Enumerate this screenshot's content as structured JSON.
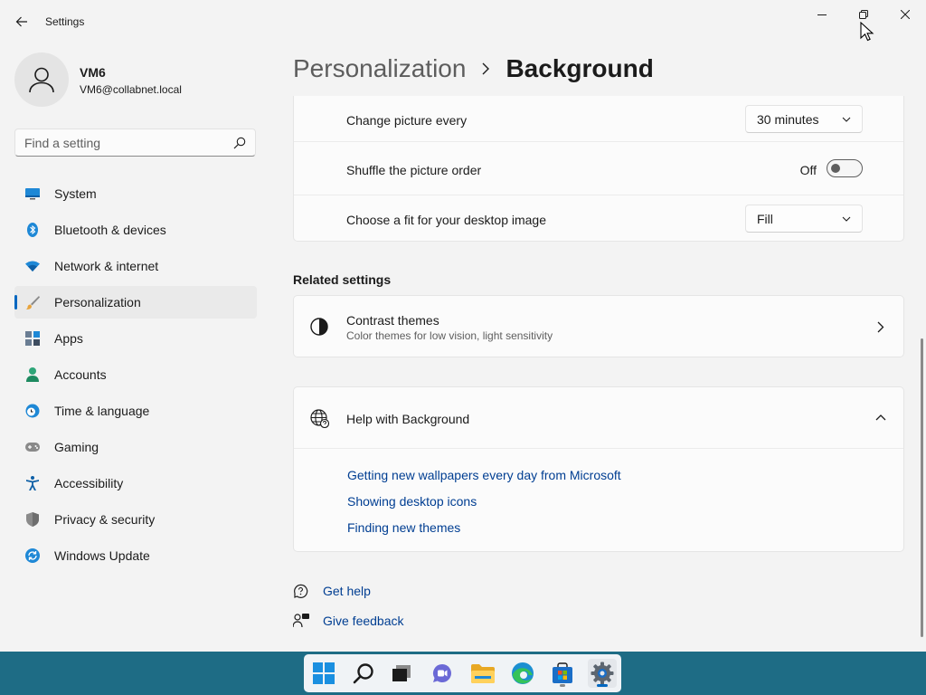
{
  "window": {
    "title": "Settings",
    "minimize_glyph": "—",
    "accent": "#0067c0"
  },
  "user": {
    "name": "VM6",
    "email": "VM6@collabnet.local"
  },
  "search": {
    "placeholder": "Find a setting"
  },
  "nav": [
    {
      "label": "System",
      "icon": "monitor-icon"
    },
    {
      "label": "Bluetooth & devices",
      "icon": "bluetooth-icon"
    },
    {
      "label": "Network & internet",
      "icon": "wifi-icon"
    },
    {
      "label": "Personalization",
      "icon": "brush-icon",
      "active": true
    },
    {
      "label": "Apps",
      "icon": "apps-icon"
    },
    {
      "label": "Accounts",
      "icon": "person-icon"
    },
    {
      "label": "Time & language",
      "icon": "globe-clock-icon"
    },
    {
      "label": "Gaming",
      "icon": "gamepad-icon"
    },
    {
      "label": "Accessibility",
      "icon": "accessibility-icon"
    },
    {
      "label": "Privacy & security",
      "icon": "shield-icon"
    },
    {
      "label": "Windows Update",
      "icon": "update-icon"
    }
  ],
  "breadcrumb": {
    "parent": "Personalization",
    "current": "Background"
  },
  "slideshow": {
    "change_label": "Change picture every",
    "change_value": "30 minutes",
    "shuffle_label": "Shuffle the picture order",
    "shuffle_state": "Off",
    "fit_label": "Choose a fit for your desktop image",
    "fit_value": "Fill"
  },
  "related": {
    "title": "Related settings",
    "contrast_title": "Contrast themes",
    "contrast_desc": "Color themes for low vision, light sensitivity"
  },
  "help": {
    "title": "Help with Background",
    "links": [
      "Getting new wallpapers every day from Microsoft",
      "Showing desktop icons",
      "Finding new themes"
    ]
  },
  "footer": {
    "get_help": "Get help",
    "give_feedback": "Give feedback"
  },
  "taskbar": {
    "color": "#1e6c85",
    "apps": [
      "start-icon",
      "search-icon",
      "task-view-icon",
      "chat-icon",
      "file-explorer-icon",
      "edge-icon",
      "store-icon",
      "settings-icon"
    ]
  }
}
